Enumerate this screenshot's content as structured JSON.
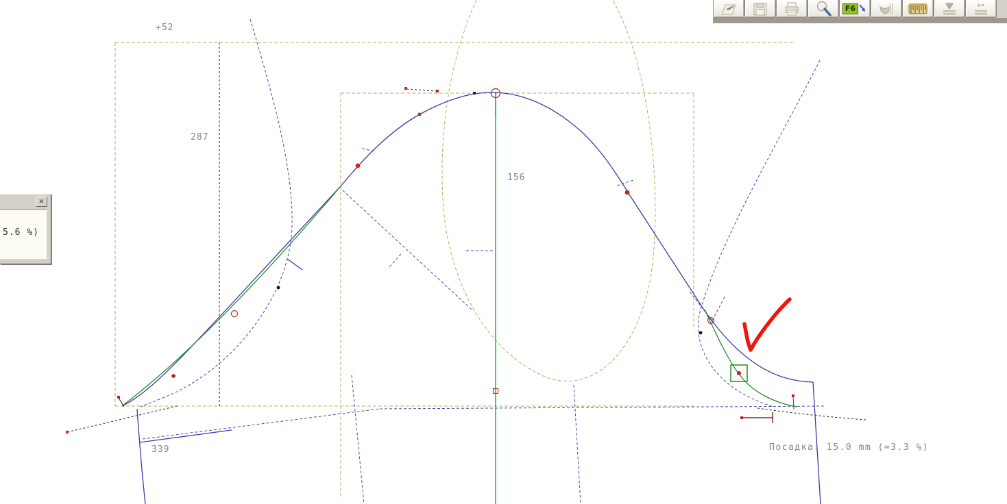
{
  "toolbar": {
    "f6_label": "F6",
    "buttons": [
      {
        "icon": "open-icon"
      },
      {
        "icon": "save-icon"
      },
      {
        "icon": "print-icon"
      },
      {
        "icon": "zoom-icon"
      },
      {
        "icon": "f6-grading-icon"
      },
      {
        "icon": "cup-icon"
      },
      {
        "icon": "measure-tape-icon"
      },
      {
        "icon": "download-lines-icon"
      },
      {
        "icon": "export-lines-icon"
      }
    ]
  },
  "dialog": {
    "close_glyph": "×",
    "value_fragment": "5.6 %)"
  },
  "canvas": {
    "labels": {
      "offset_top": "+52",
      "back_width": "287",
      "cap_center": "156",
      "hem": "339",
      "status": "Посадка: 15.0 mm (=3.3 %)"
    }
  },
  "colors": {
    "construction_olive": "#b2b25e",
    "curve_blue": "#3a3aae",
    "dashed_blue": "#4444b8",
    "curve_green": "#1e8e1e",
    "axis_green": "#2abf2a",
    "point_red": "#cc2418",
    "checkmark_red": "#ee1512",
    "label_gray": "#858585",
    "f6_green": "#96c11f"
  }
}
